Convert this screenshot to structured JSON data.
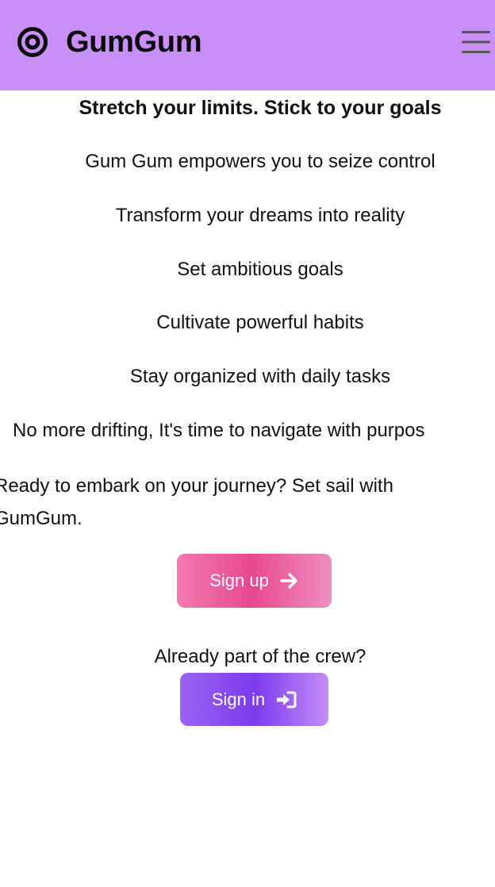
{
  "header": {
    "title": "GumGum",
    "logo_icon": "target-icon",
    "menu_icon": "hamburger-menu-icon",
    "background": "#c98ff8"
  },
  "main": {
    "headline": "Stretch your limits. Stick to your goals",
    "lines": [
      "Gum Gum empowers you to seize control",
      "Transform your dreams into reality",
      "Set ambitious goals",
      "Cultivate powerful habits",
      "Stay organized with daily tasks",
      "No more drifting, It's time to navigate with purpos"
    ],
    "ready_text": "Ready to embark on your journey? Set sail with GumGum.",
    "signup_label": "Sign up",
    "signup_icon": "arrow-right-icon",
    "already_text": "Already part of the crew?",
    "signin_label": "Sign in",
    "signin_icon": "sign-in-icon"
  },
  "colors": {
    "signup_gradient": [
      "#f27bb0",
      "#e8488f",
      "#ee8fc0"
    ],
    "signin_gradient": [
      "#9b63f5",
      "#7c3aed",
      "#c58cf9"
    ]
  }
}
